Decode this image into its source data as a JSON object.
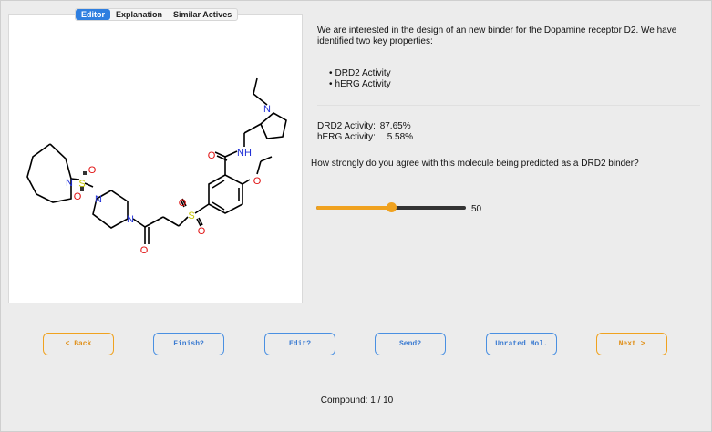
{
  "tabs": [
    {
      "label": "Editor",
      "active": true
    },
    {
      "label": "Explanation",
      "active": false
    },
    {
      "label": "Similar Actives",
      "active": false
    }
  ],
  "molecule": {
    "atom_labels": [
      "N",
      "S",
      "O",
      "O",
      "N",
      "N",
      "O",
      "S",
      "O",
      "O",
      "O",
      "NH",
      "O",
      "N"
    ]
  },
  "intro_text": "We are interested in the design of an new  binder for the Dopamine receptor D2. We have identified two key properties:",
  "properties": [
    "DRD2 Activity",
    "hERG Activity"
  ],
  "scores": {
    "drd2_label": "DRD2 Activity:",
    "drd2_value": "87.65%",
    "herg_label": "hERG Activity:",
    "herg_value": "5.58%"
  },
  "question": "How strongly do you agree with this molecule being predicted as a DRD2 binder?",
  "slider": {
    "value": 50,
    "min": 0,
    "max": 100,
    "display": "50"
  },
  "buttons": {
    "back": "< Back",
    "finish": "Finish?",
    "edit": "Edit?",
    "send": "Send?",
    "unrated": "Unrated Mol.",
    "next": "Next >"
  },
  "footer": "Compound: 1 / 10",
  "colors": {
    "accent_blue": "#4a90e2",
    "accent_orange": "#f0a21f",
    "nitrogen": "#1f2fd6",
    "oxygen": "#e01010",
    "sulfur": "#c8c800"
  }
}
